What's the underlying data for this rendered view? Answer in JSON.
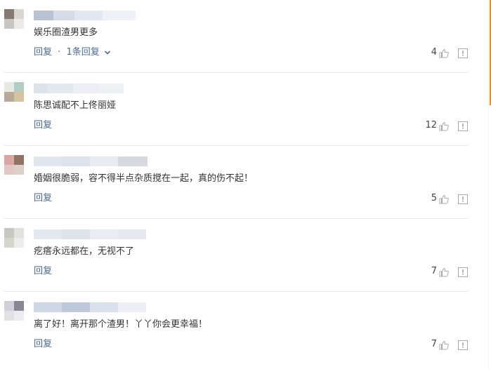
{
  "ui": {
    "reply_label": "回复",
    "reply_separator": "·",
    "report_icon": "report-icon",
    "like_icon": "thumb-up-icon",
    "accent_color": "#f28a2a"
  },
  "comments": [
    {
      "text": "娱乐圈渣男更多",
      "likes": "4",
      "thread_label": "1条回复",
      "has_thread": true
    },
    {
      "text": "陈思诚配不上佟丽娅",
      "likes": "12",
      "thread_label": "",
      "has_thread": false
    },
    {
      "text": "婚姻很脆弱，容不得半点杂质搅在一起，真的伤不起！",
      "likes": "5",
      "thread_label": "",
      "has_thread": false
    },
    {
      "text": "疙瘩永远都在，无视不了",
      "likes": "7",
      "thread_label": "",
      "has_thread": false
    },
    {
      "text": "离了好！离开那个渣男！丫丫你会更幸福！",
      "likes": "7",
      "thread_label": "",
      "has_thread": false
    }
  ]
}
